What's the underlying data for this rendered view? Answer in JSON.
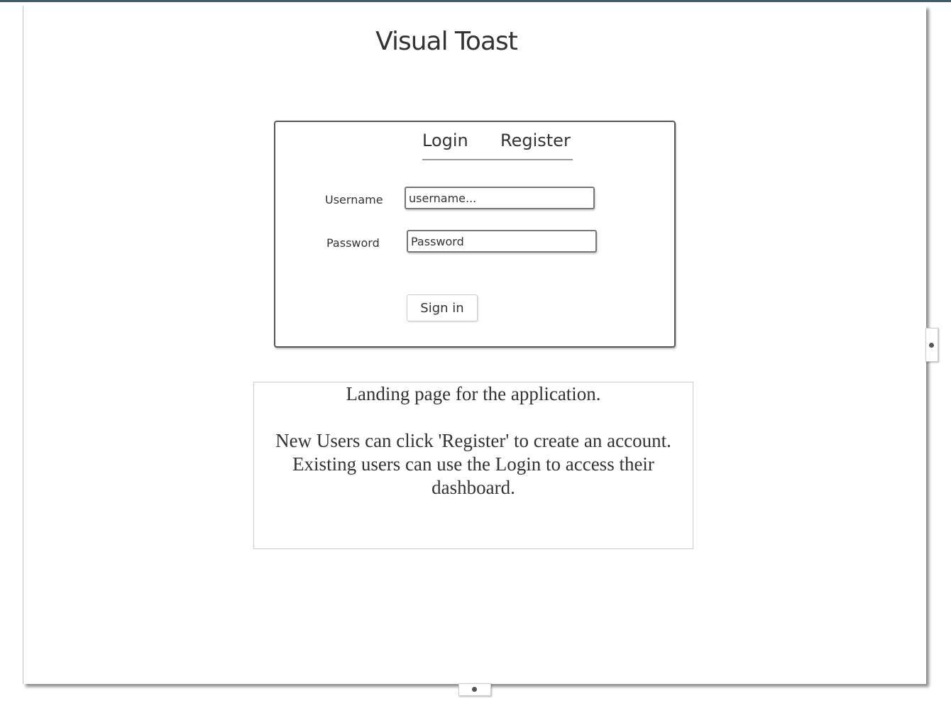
{
  "app": {
    "title": "Visual Toast"
  },
  "login_box": {
    "tabs": [
      {
        "label": "Login"
      },
      {
        "label": "Register"
      }
    ],
    "username_label": "Username",
    "username_placeholder": "username...",
    "password_label": "Password",
    "password_placeholder": "Password",
    "signin_label": "Sign in"
  },
  "note": {
    "line1": "Landing page for the application.",
    "line2": "New Users can click 'Register' to create an account.",
    "line3": "Existing users can use the Login to access their",
    "line4": "dashboard."
  },
  "icons": {
    "resize_handle_right": "drag-handle-icon",
    "resize_handle_bottom": "drag-handle-icon"
  },
  "colors": {
    "top_bar": "#3e5a6e",
    "sketch_stroke": "#555555",
    "text": "#333333"
  }
}
